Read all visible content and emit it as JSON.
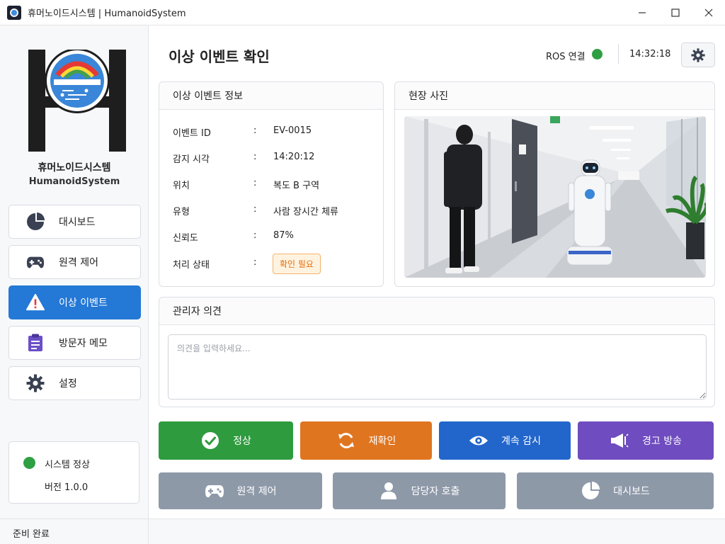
{
  "window": {
    "title": "휴머노이드시스템 | HumanoidSystem"
  },
  "sidebar": {
    "brand_kr": "휴머노이드시스템",
    "brand_en": "HumanoidSystem",
    "items": [
      {
        "label": "대시보드",
        "icon": "pie-chart-icon"
      },
      {
        "label": "원격 제어",
        "icon": "gamepad-icon"
      },
      {
        "label": "이상 이벤트",
        "icon": "warning-icon",
        "active": true
      },
      {
        "label": "방문자 메모",
        "icon": "clipboard-icon"
      },
      {
        "label": "설정",
        "icon": "gear-icon"
      }
    ],
    "status": {
      "text": "시스템 정상",
      "version": "버전 1.0.0",
      "color": "#2ea043"
    }
  },
  "header": {
    "title": "이상 이벤트 확인",
    "ros_label": "ROS 연결",
    "ros_color": "#2ea043",
    "time": "14:32:18"
  },
  "event_info": {
    "title": "이상 이벤트 정보",
    "separator": ":",
    "rows": [
      {
        "label": "이벤트 ID",
        "value": "EV-0015"
      },
      {
        "label": "감지 시각",
        "value": "14:20:12"
      },
      {
        "label": "위치",
        "value": "복도 B 구역"
      },
      {
        "label": "유형",
        "value": "사람 장시간 체류"
      },
      {
        "label": "신뢰도",
        "value": "87%"
      },
      {
        "label": "처리 상태",
        "value": "확인 필요"
      }
    ]
  },
  "photo": {
    "title": "현장 사진"
  },
  "comment": {
    "title": "관리자 의견",
    "placeholder": "의견을 입력하세요...",
    "value": ""
  },
  "actions": {
    "primary": [
      {
        "label": "정상",
        "icon": "check-circle-icon",
        "color": "#2e9b3e"
      },
      {
        "label": "재확인",
        "icon": "refresh-icon",
        "color": "#e07520"
      },
      {
        "label": "계속 감시",
        "icon": "eye-icon",
        "color": "#2266cc"
      },
      {
        "label": "경고 방송",
        "icon": "megaphone-icon",
        "color": "#6f4cbf"
      }
    ],
    "secondary": [
      {
        "label": "원격 제어",
        "icon": "gamepad-icon"
      },
      {
        "label": "담당자 호출",
        "icon": "person-icon"
      },
      {
        "label": "대시보드",
        "icon": "pie-chart-icon"
      }
    ]
  },
  "statusbar": {
    "text": "준비 완료"
  }
}
